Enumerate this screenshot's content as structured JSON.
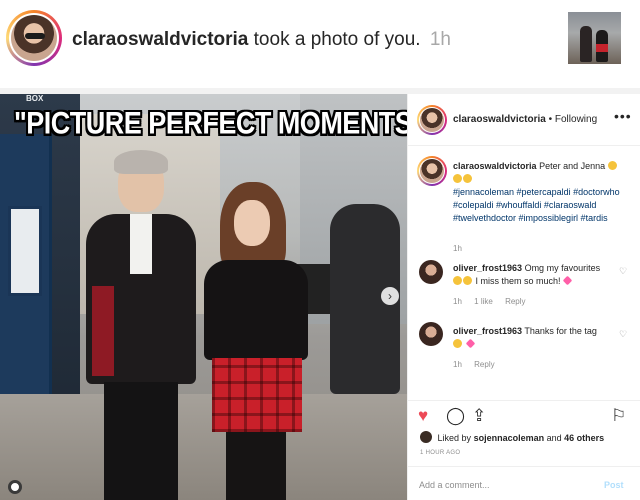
{
  "notification": {
    "username": "claraoswaldvictoria",
    "action": "took a photo of you.",
    "time": "1h"
  },
  "photo": {
    "caption": "\"PICTURE PERFECT MOMENTS\"",
    "sign_text": "BOX"
  },
  "post": {
    "username": "claraoswaldvictoria",
    "follow_status": "• Following",
    "caption_text": "Peter and Jenna",
    "hashtags": "#jennacoleman #petercapaldi #doctorwho #colepaldi #whouffaldi #claraoswald #twelvethdoctor #impossiblegirl #tardis",
    "caption_time": "1h",
    "comments": [
      {
        "username": "oliver_frost1963",
        "text": "Omg my favourites",
        "text2": "I miss them so much!",
        "time": "1h",
        "likes": "1 like",
        "reply": "Reply"
      },
      {
        "username": "oliver_frost1963",
        "text": "Thanks for the tag",
        "time": "1h",
        "reply": "Reply"
      }
    ],
    "likes_prefix": "Liked by",
    "likes_user": "sojennacoleman",
    "likes_and": "and",
    "likes_others": "46 others",
    "ago": "1 HOUR AGO",
    "add_comment_placeholder": "Add a comment...",
    "post_label": "Post"
  },
  "icons": {
    "more": "•••",
    "heart": "♥",
    "comment": "◯",
    "share": "⇪",
    "save": "⚐",
    "like_small": "♡",
    "next": "›"
  },
  "colors": {
    "heart_active": "#ed4956",
    "hashtag": "#003569",
    "post_disabled": "#b2dffc"
  }
}
